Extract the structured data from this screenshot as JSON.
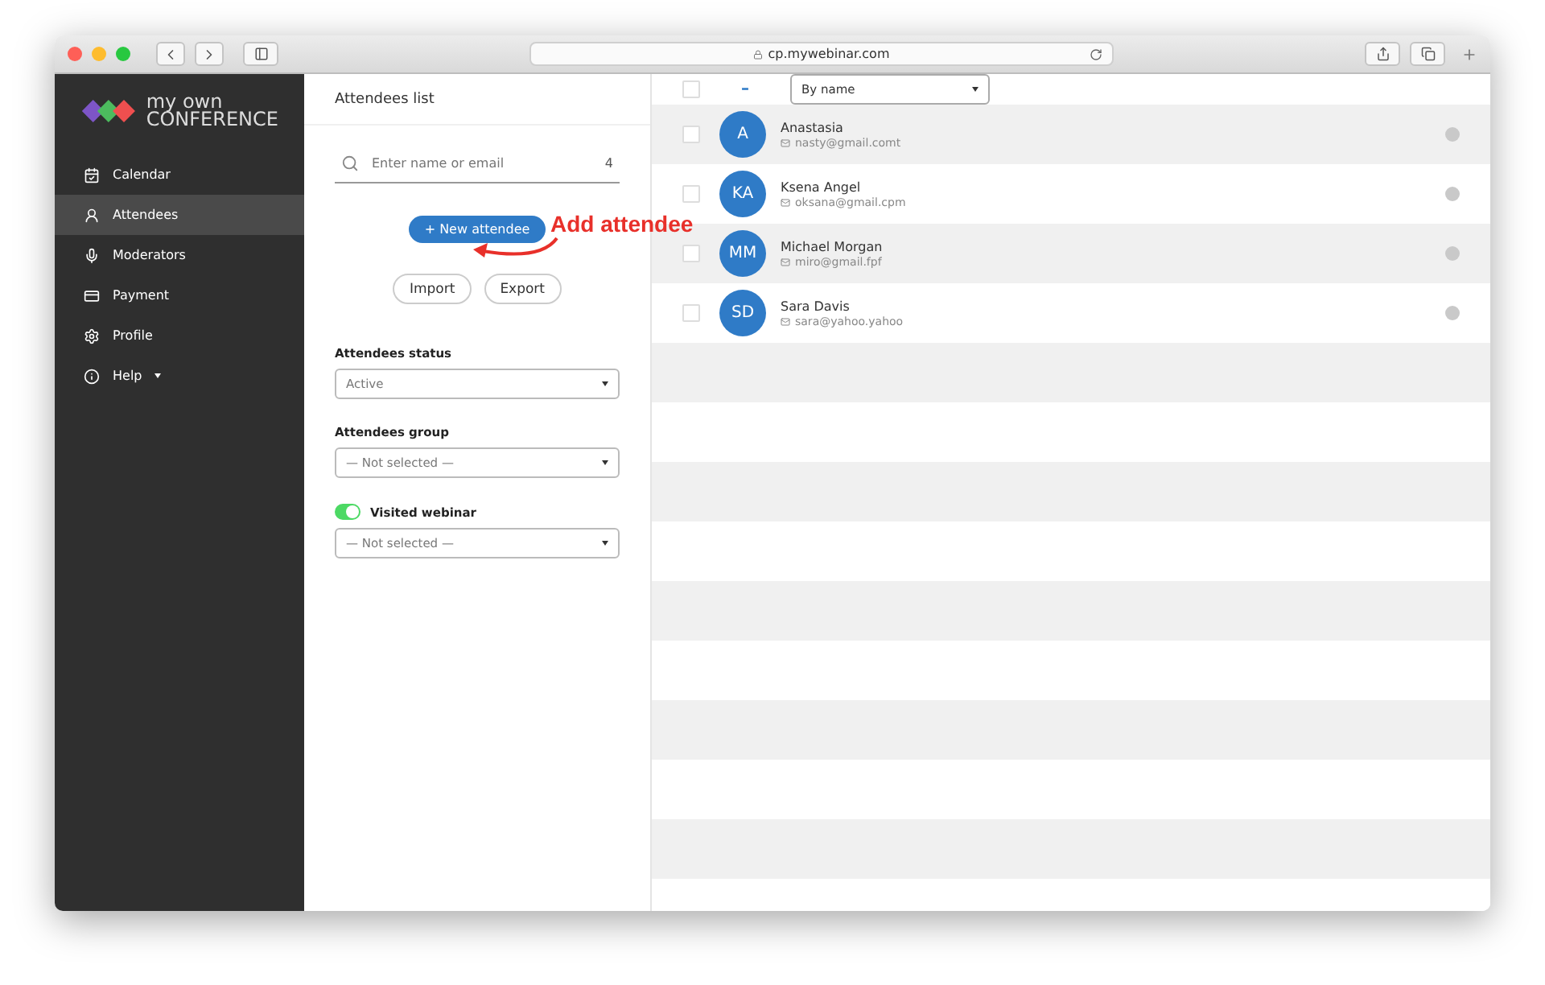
{
  "browser": {
    "url": "cp.mywebinar.com"
  },
  "logo": {
    "line_1": "my own",
    "line_2": "CONFERENCE"
  },
  "sidebar": {
    "items": [
      {
        "kind": "calendar",
        "label": "Calendar",
        "selected": false
      },
      {
        "kind": "attendees",
        "label": "Attendees",
        "selected": true
      },
      {
        "kind": "moderators",
        "label": "Moderators",
        "selected": false
      },
      {
        "kind": "payment",
        "label": "Payment",
        "selected": false
      },
      {
        "kind": "profile",
        "label": "Profile",
        "selected": false
      },
      {
        "kind": "help",
        "label": "Help",
        "selected": false,
        "dropdown": true
      }
    ]
  },
  "panel": {
    "title": "Attendees list",
    "search": {
      "placeholder": "Enter name or email",
      "count": "4"
    },
    "new_button": "+ New attendee",
    "import_button": "Import",
    "export_button": "Export",
    "filters": [
      {
        "label": "Attendees status",
        "value": "Active"
      },
      {
        "label": "Attendees group",
        "value": "— Not selected —"
      },
      {
        "label": "Visited webinar",
        "toggle": true,
        "on": true,
        "value": "— Not selected —"
      }
    ]
  },
  "annotation": "Add attendee",
  "list": {
    "select_all": {
      "checked": false
    },
    "collapse": "–",
    "sort": "By name",
    "rows": [
      {
        "initials": "A",
        "name": "Anastasia",
        "email": "nasty@gmail.comt",
        "checked": false
      },
      {
        "initials": "KA",
        "name": "Ksena Angel",
        "email": "oksana@gmail.cpm",
        "checked": false
      },
      {
        "initials": "MM",
        "name": "Michael Morgan",
        "email": "miro@gmail.fpf",
        "checked": false
      },
      {
        "initials": "SD",
        "name": "Sara Davis",
        "email": "sara@yahoo.yahoo",
        "checked": false
      }
    ]
  }
}
